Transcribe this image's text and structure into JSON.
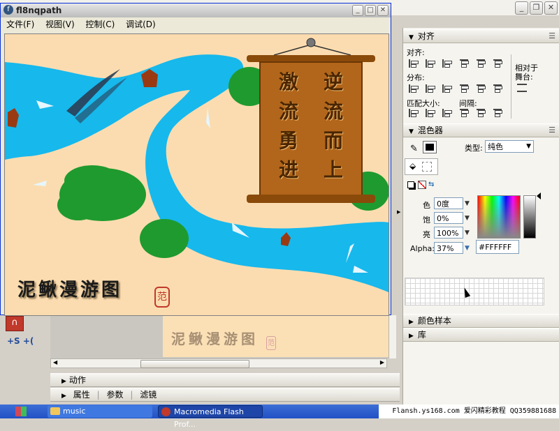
{
  "player": {
    "title": "fl8nqpath",
    "menu": [
      "文件(F)",
      "视图(V)",
      "控制(C)",
      "调试(D)"
    ],
    "scroll_left": [
      "激",
      "流",
      "勇",
      "进"
    ],
    "scroll_right": [
      "逆",
      "流",
      "而",
      "上"
    ],
    "map_title": "泥鳅漫游图",
    "seal": "范"
  },
  "align_panel": {
    "title": "对齐",
    "align_label": "对齐:",
    "distribute_label": "分布:",
    "match_size_label": "匹配大小:",
    "spacing_label": "间隔:",
    "relative_to_stage": "相对于\n舞台:"
  },
  "mixer_panel": {
    "title": "混色器",
    "type_label": "类型:",
    "type_value": "纯色",
    "hue_label": "色",
    "hue_value": "0度",
    "sat_label": "饱",
    "sat_value": "0%",
    "bright_label": "亮",
    "bright_value": "100%",
    "alpha_label": "Alpha:",
    "alpha_value": "37%",
    "hex_value": "#FFFFFF"
  },
  "panels_collapsed": [
    "颜色样本",
    "库"
  ],
  "bottom_panels": [
    "动作",
    "属性",
    "参数",
    "滤镜"
  ],
  "tool_text": "+S +(",
  "taskbar": {
    "items": [
      "music",
      "Macromedia Flash Prof..."
    ],
    "tray_text": "Flansh.ys168.com 爱闪精彩教程 QQ359881688"
  },
  "colors": {
    "river": "#17b8ec",
    "sand": "#fbdcb0",
    "tree": "#1f9a2e",
    "scroll_wood": "#a05a10",
    "title_bar": "#c8c8c8"
  }
}
